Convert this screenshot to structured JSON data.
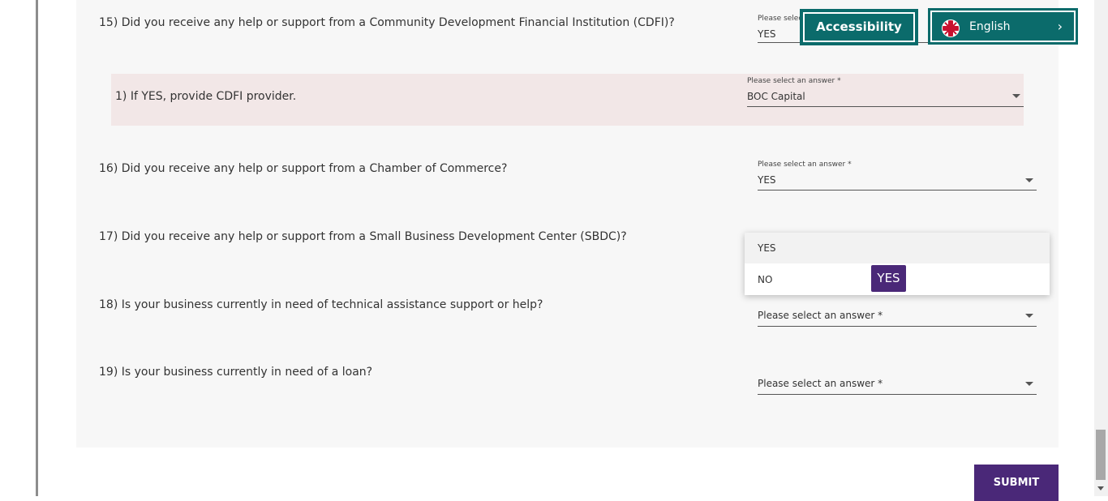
{
  "header": {
    "accessibility_label": "Accessibility",
    "language_label": "English",
    "language_chevron": "›"
  },
  "questions": {
    "q15": {
      "text": "15) Did you receive any help or support from a Community Development Financial Institution (CDFI)?",
      "label": "Please selec",
      "value": "YES"
    },
    "q15_sub": {
      "text": "1) If YES, provide CDFI provider.",
      "label": "Please select an answer  *",
      "value": "BOC Capital"
    },
    "q16": {
      "text": "16) Did you receive any help or support from a Chamber of Commerce?",
      "label": "Please select an answer *",
      "value": "YES"
    },
    "q17": {
      "text": "17) Did you receive any help or support from a Small Business Development Center (SBDC)?"
    },
    "q18": {
      "text": "18) Is your business currently in need of technical assistance support or help?",
      "placeholder": "Please select an answer *"
    },
    "q19": {
      "text": "19) Is your business currently in need of a loan?",
      "placeholder": "Please select an answer *"
    }
  },
  "dropdown": {
    "options": [
      "YES",
      "NO"
    ],
    "tooltip": "YES"
  },
  "submit_label": "SUBMIT",
  "colors": {
    "teal": "#0b6b6b",
    "purple": "#4a2878",
    "panel_bg": "#f7f7f7",
    "highlight_bg": "#f2e7e7"
  }
}
